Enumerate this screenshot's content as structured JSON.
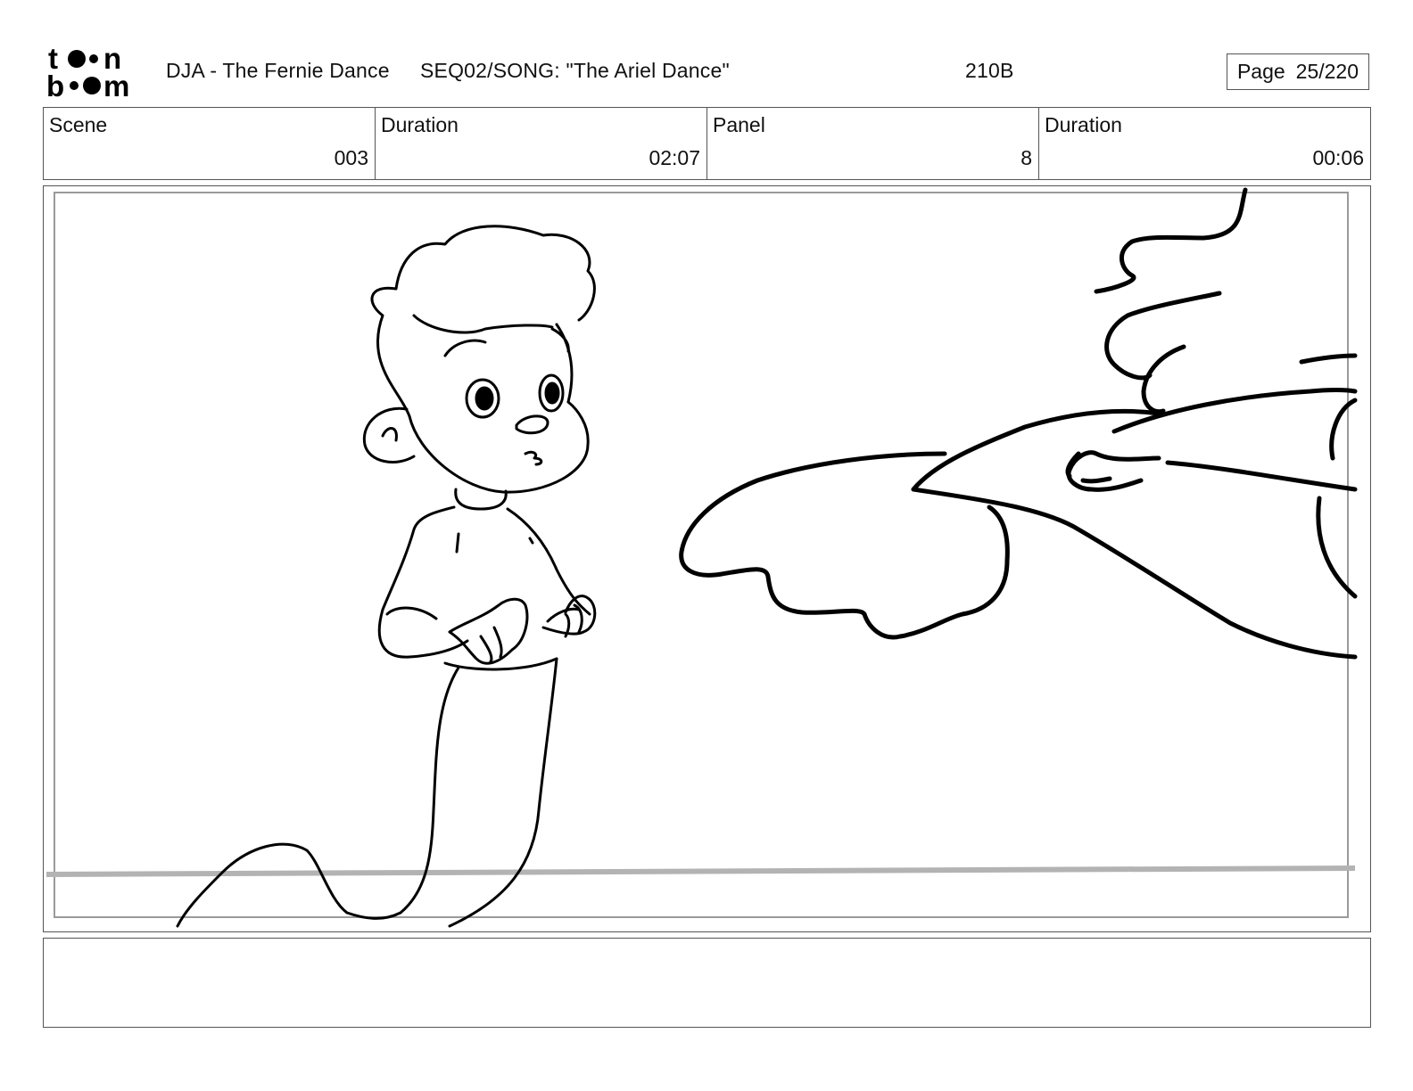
{
  "header": {
    "logo_text": "toon boom",
    "project_title": "DJA - The Fernie Dance",
    "sequence_title": "SEQ02/SONG: \"The Ariel Dance\"",
    "shot_code": "210B",
    "page_label": "Page",
    "page_value": "25/220"
  },
  "info": {
    "scene_label": "Scene",
    "scene_value": "003",
    "scene_duration_label": "Duration",
    "scene_duration_value": "02:07",
    "panel_label": "Panel",
    "panel_value": "8",
    "panel_duration_label": "Duration",
    "panel_duration_value": "00:06"
  },
  "panel": {
    "description": "",
    "colors": {
      "line": "#000000",
      "safe_frame": "#9a9a9a",
      "horizon": "#b3b3b3"
    }
  },
  "notes": {
    "text": ""
  }
}
